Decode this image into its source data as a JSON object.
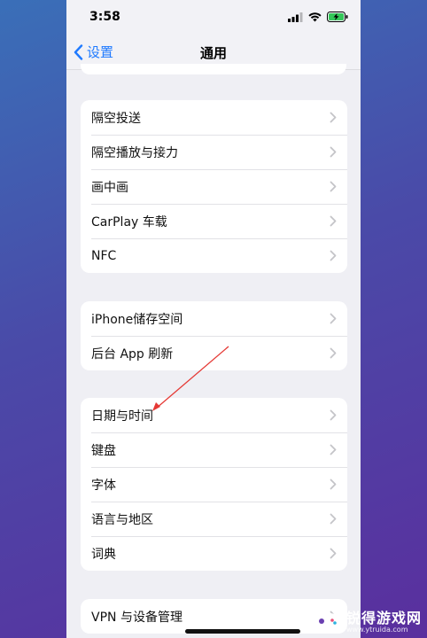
{
  "status_bar": {
    "time": "3:58",
    "icons": [
      "signal-icon",
      "wifi-icon",
      "battery-charging-icon"
    ]
  },
  "nav": {
    "back_label": "设置",
    "title": "通用"
  },
  "groups": [
    [
      "隔空投送",
      "隔空播放与接力",
      "画中画",
      "CarPlay 车载",
      "NFC"
    ],
    [
      "iPhone储存空间",
      "后台 App 刷新"
    ],
    [
      "日期与时间",
      "键盘",
      "字体",
      "语言与地区",
      "词典"
    ],
    [
      "VPN 与设备管理"
    ]
  ],
  "annotation": {
    "color": "#e53935",
    "points_to": "日期与时间"
  },
  "watermark": {
    "title": "锐得游戏网",
    "url": "www.ytruida.com"
  },
  "colors": {
    "accent": "#1f7aff",
    "background": "#efeff4"
  }
}
